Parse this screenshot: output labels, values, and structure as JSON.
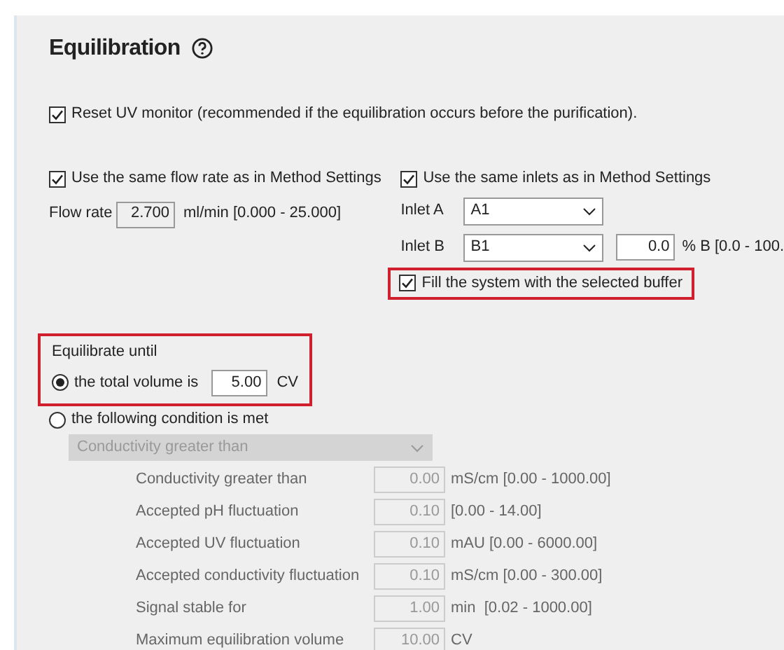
{
  "title": "Equilibration",
  "reset_uv": {
    "label": "Reset UV monitor (recommended if the equilibration occurs before the purification).",
    "checked": true
  },
  "flow": {
    "same": {
      "label": "Use the same flow rate as in Method Settings",
      "checked": true
    },
    "label": "Flow rate",
    "value": "2.700",
    "unit": "ml/min [0.000 - 25.000]"
  },
  "inlets": {
    "same": {
      "label": "Use the same inlets as in Method Settings",
      "checked": true
    },
    "inlet_a": {
      "label": "Inlet A",
      "value": "A1"
    },
    "inlet_b": {
      "label": "Inlet B",
      "value": "B1",
      "percent": "0.0",
      "unit": "% B [0.0 - 100."
    },
    "fill": {
      "label": "Fill the system with the selected buffer",
      "checked": true,
      "highlighted": true
    }
  },
  "equilibrate": {
    "heading": "Equilibrate until",
    "highlighted": true,
    "options": [
      {
        "label": "the total volume is",
        "selected": true,
        "value": "5.00",
        "unit": "CV"
      },
      {
        "label": "the following condition is met",
        "selected": false
      }
    ]
  },
  "condition": {
    "value": "Conductivity greater than",
    "disabled": true
  },
  "parameters": [
    {
      "label": "Conductivity greater than",
      "value": "0.00",
      "unit": "mS/cm [0.00 - 1000.00]"
    },
    {
      "label": "Accepted pH fluctuation",
      "value": "0.10",
      "unit": "[0.00 - 14.00]"
    },
    {
      "label": "Accepted UV fluctuation",
      "value": "0.10",
      "unit": "mAU [0.00 - 6000.00]"
    },
    {
      "label": "Accepted conductivity fluctuation",
      "value": "0.10",
      "unit": "mS/cm [0.00 - 300.00]"
    },
    {
      "label": "Signal stable for",
      "value": "1.00",
      "unit": "min  [0.02 - 1000.00]"
    },
    {
      "label": "Maximum equilibration volume",
      "value": "10.00",
      "unit": "CV"
    }
  ]
}
